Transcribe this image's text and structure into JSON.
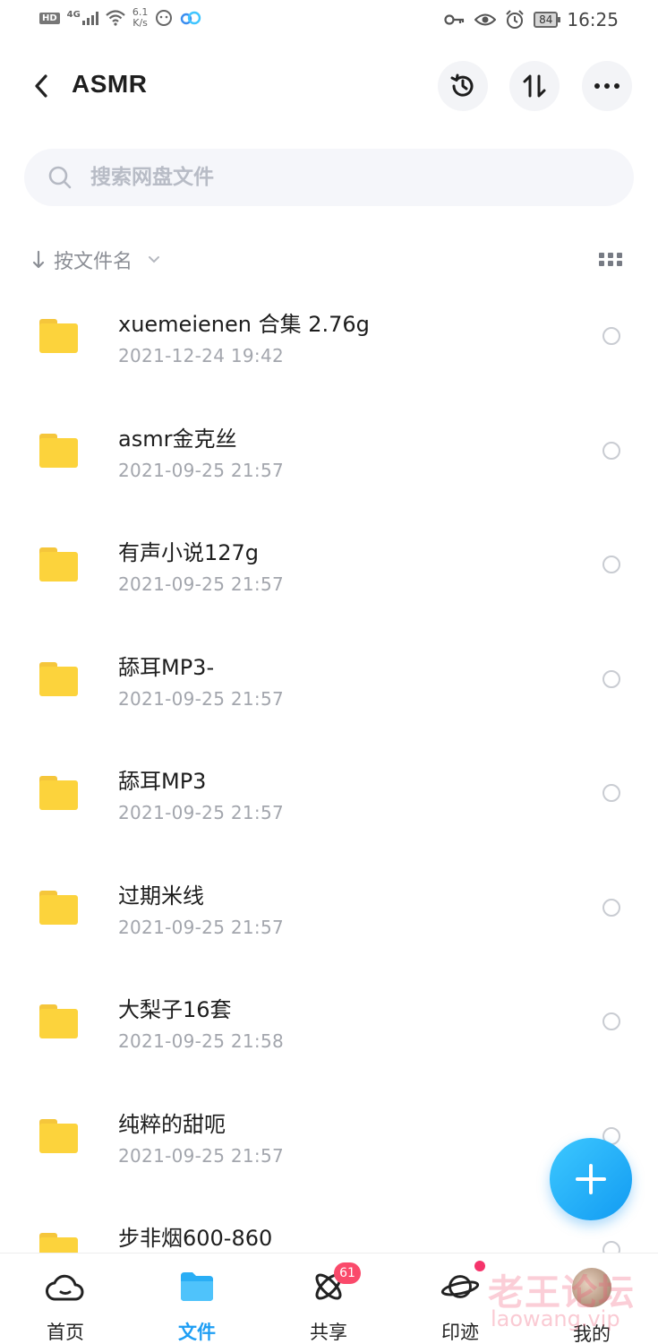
{
  "status_bar": {
    "hd": "HD",
    "network": "4G",
    "speed_value": "6.1",
    "speed_unit": "K/s",
    "battery": "84",
    "time": "16:25"
  },
  "header": {
    "title": "ASMR",
    "icons": [
      "back-arrow-icon",
      "history-icon",
      "sort-arrows-icon",
      "more-icon"
    ]
  },
  "search": {
    "placeholder": "搜索网盘文件"
  },
  "sort": {
    "label": "按文件名"
  },
  "files": [
    {
      "name": "xuemeienen 合集 2.76g",
      "date": "2021-12-24  19:42"
    },
    {
      "name": "asmr金克丝",
      "date": "2021-09-25  21:57"
    },
    {
      "name": "有声小说127g",
      "date": "2021-09-25  21:57"
    },
    {
      "name": "舔耳MP3-",
      "date": "2021-09-25  21:57"
    },
    {
      "name": "舔耳MP3",
      "date": "2021-09-25  21:57"
    },
    {
      "name": "过期米线",
      "date": "2021-09-25  21:57"
    },
    {
      "name": "大梨子16套",
      "date": "2021-09-25  21:58"
    },
    {
      "name": "纯粹的甜呃",
      "date": "2021-09-25  21:57"
    },
    {
      "name": "步非烟600-860",
      "date": ""
    }
  ],
  "bottom_nav": {
    "home": "首页",
    "files": "文件",
    "share": "共享",
    "share_badge": "61",
    "moments": "印迹",
    "me": "我的"
  },
  "watermark": {
    "text": "老王论坛",
    "url": "laowang.vip"
  },
  "colors": {
    "accent": "#1e9ef4",
    "folder": "#fcd33c",
    "badge": "#fa4a6b"
  }
}
